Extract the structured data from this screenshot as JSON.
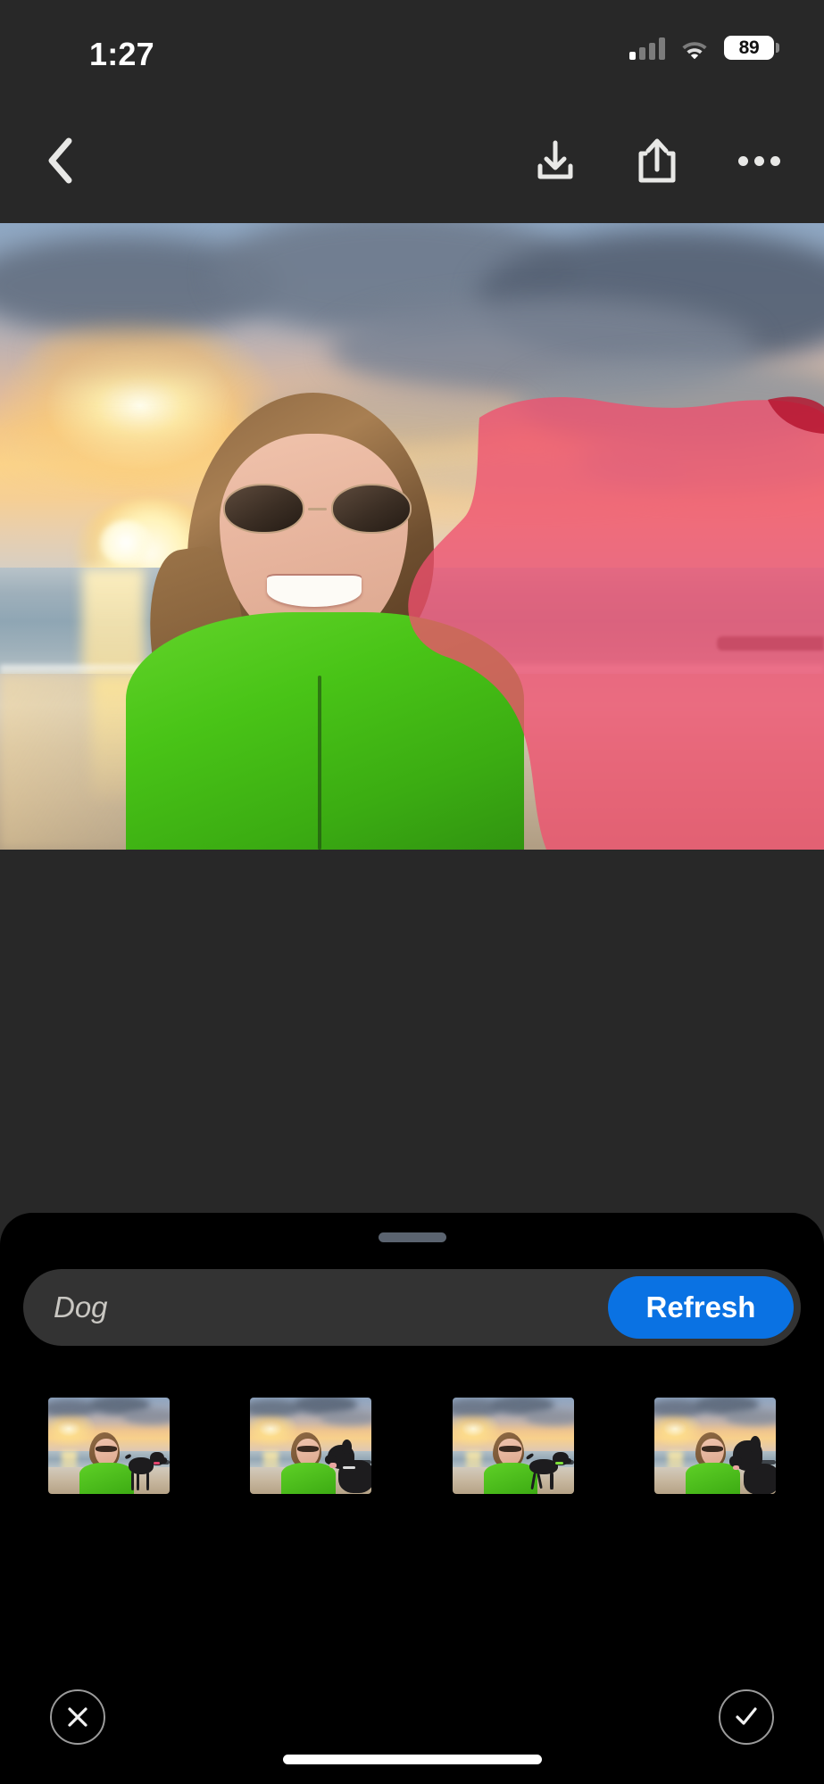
{
  "status_bar": {
    "time": "1:27",
    "battery_level": "89",
    "signal_icon": "cellular-signal-icon",
    "wifi_icon": "wifi-icon",
    "battery_icon": "battery-icon"
  },
  "toolbar": {
    "back_icon": "chevron-left-icon",
    "download_icon": "download-icon",
    "share_icon": "share-icon",
    "more_icon": "more-options-icon"
  },
  "editor": {
    "photo_description": "Beach sunset selfie of a woman in a green hoodie and sunglasses",
    "mask_color": "#F0506E",
    "mask_label": "selection-brush-mask"
  },
  "prompt": {
    "value": "Dog",
    "placeholder": "Dog",
    "refresh_label": "Refresh",
    "refresh_color": "#0A72E3"
  },
  "variations": [
    {
      "label": "variation-1"
    },
    {
      "label": "variation-2"
    },
    {
      "label": "variation-3"
    },
    {
      "label": "variation-4"
    }
  ],
  "actions": {
    "cancel_icon": "close-icon",
    "confirm_icon": "checkmark-icon"
  }
}
